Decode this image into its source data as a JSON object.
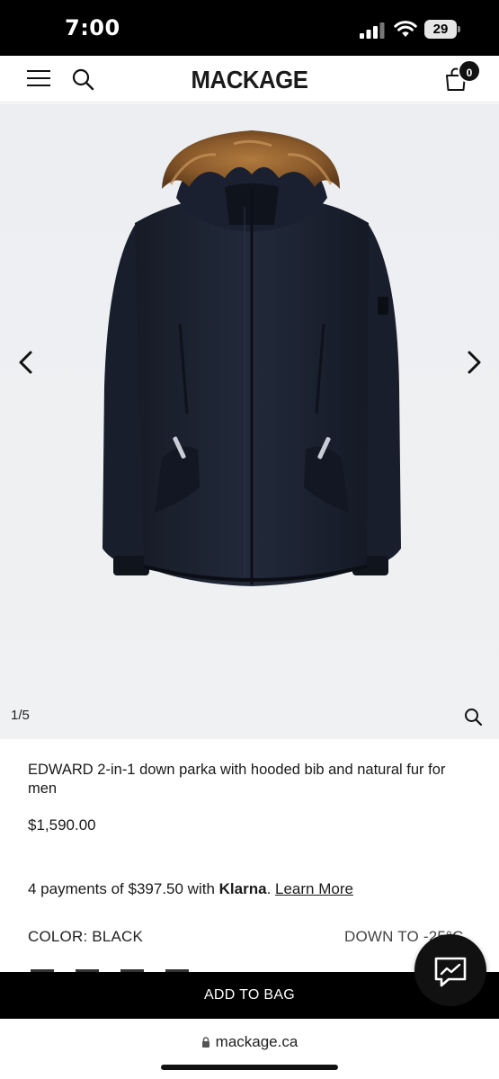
{
  "status_bar": {
    "time": "7:00",
    "battery": "29"
  },
  "header": {
    "logo": "MACKAGE",
    "cart_count": "0"
  },
  "gallery": {
    "counter": "1/5"
  },
  "product": {
    "title": "EDWARD 2-in-1 down parka with hooded bib and natural fur for men",
    "price": "$1,590.00",
    "installments": {
      "prefix": "4 payments of $397.50 with ",
      "brand": "Klarna",
      "suffix": ". ",
      "link": "Learn More"
    },
    "color_label": "COLOR: BLACK",
    "temperature_label": "DOWN TO -25°C"
  },
  "actions": {
    "add_to_bag": "ADD TO BAG"
  },
  "browser": {
    "url": "mackage.ca"
  },
  "colors": {
    "accent": "#000000",
    "gallery_bg": "#eef0f2",
    "jacket": "#1c2230",
    "fur": "#8a5a2b"
  }
}
